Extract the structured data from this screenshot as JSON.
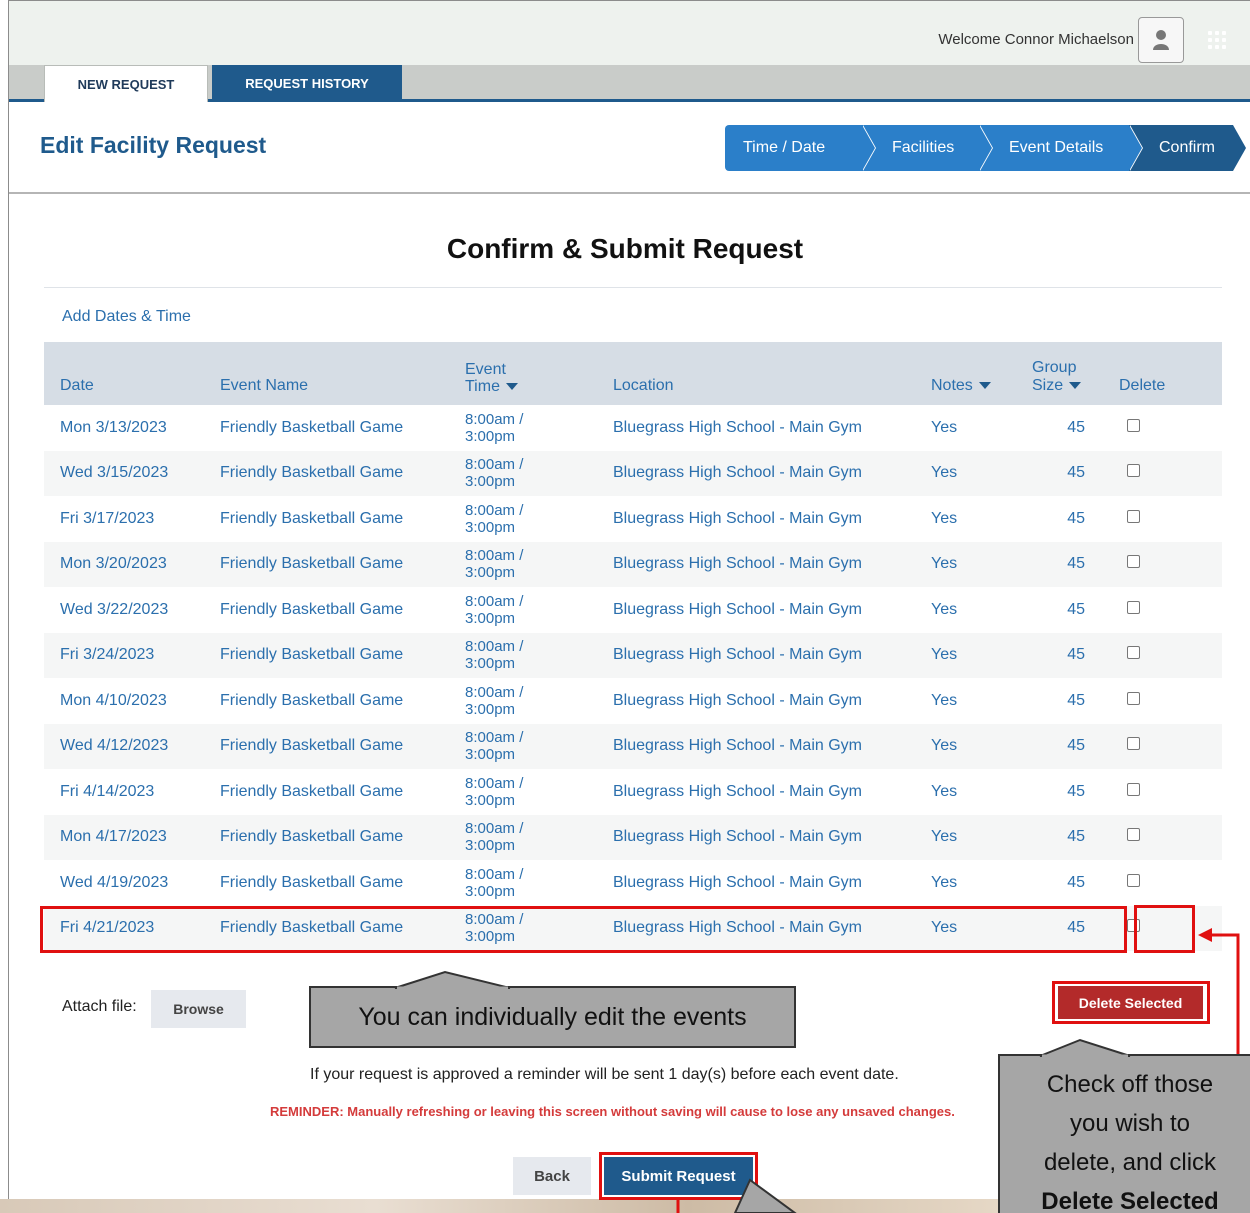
{
  "header": {
    "welcome": "Welcome Connor Michaelson",
    "tabs": [
      {
        "label": "NEW REQUEST",
        "active": true
      },
      {
        "label": "REQUEST HISTORY",
        "active": false
      }
    ]
  },
  "page": {
    "title": "Edit Facility Request",
    "steps": [
      "Time / Date",
      "Facilities",
      "Event Details",
      "Confirm"
    ],
    "heading": "Confirm & Submit Request",
    "add_link": "Add Dates & Time"
  },
  "table": {
    "columns": {
      "date": "Date",
      "event_name": "Event Name",
      "event_time": [
        "Event",
        "Time"
      ],
      "location": "Location",
      "notes": "Notes",
      "group_size": [
        "Group",
        "Size"
      ],
      "delete": "Delete"
    },
    "rows": [
      {
        "date": "Mon 3/13/2023",
        "name": "Friendly Basketball Game",
        "time1": "8:00am /",
        "time2": "3:00pm",
        "location": "Bluegrass High School - Main Gym",
        "notes": "Yes",
        "size": "45"
      },
      {
        "date": "Wed 3/15/2023",
        "name": "Friendly Basketball Game",
        "time1": "8:00am /",
        "time2": "3:00pm",
        "location": "Bluegrass High School - Main Gym",
        "notes": "Yes",
        "size": "45"
      },
      {
        "date": "Fri 3/17/2023",
        "name": "Friendly Basketball Game",
        "time1": "8:00am /",
        "time2": "3:00pm",
        "location": "Bluegrass High School - Main Gym",
        "notes": "Yes",
        "size": "45"
      },
      {
        "date": "Mon 3/20/2023",
        "name": "Friendly Basketball Game",
        "time1": "8:00am /",
        "time2": "3:00pm",
        "location": "Bluegrass High School - Main Gym",
        "notes": "Yes",
        "size": "45"
      },
      {
        "date": "Wed 3/22/2023",
        "name": "Friendly Basketball Game",
        "time1": "8:00am /",
        "time2": "3:00pm",
        "location": "Bluegrass High School - Main Gym",
        "notes": "Yes",
        "size": "45"
      },
      {
        "date": "Fri 3/24/2023",
        "name": "Friendly Basketball Game",
        "time1": "8:00am /",
        "time2": "3:00pm",
        "location": "Bluegrass High School - Main Gym",
        "notes": "Yes",
        "size": "45"
      },
      {
        "date": "Mon 4/10/2023",
        "name": "Friendly Basketball Game",
        "time1": "8:00am /",
        "time2": "3:00pm",
        "location": "Bluegrass High School - Main Gym",
        "notes": "Yes",
        "size": "45"
      },
      {
        "date": "Wed 4/12/2023",
        "name": "Friendly Basketball Game",
        "time1": "8:00am /",
        "time2": "3:00pm",
        "location": "Bluegrass High School - Main Gym",
        "notes": "Yes",
        "size": "45"
      },
      {
        "date": "Fri 4/14/2023",
        "name": "Friendly Basketball Game",
        "time1": "8:00am /",
        "time2": "3:00pm",
        "location": "Bluegrass High School - Main Gym",
        "notes": "Yes",
        "size": "45"
      },
      {
        "date": "Mon 4/17/2023",
        "name": "Friendly Basketball Game",
        "time1": "8:00am /",
        "time2": "3:00pm",
        "location": "Bluegrass High School - Main Gym",
        "notes": "Yes",
        "size": "45"
      },
      {
        "date": "Wed 4/19/2023",
        "name": "Friendly Basketball Game",
        "time1": "8:00am /",
        "time2": "3:00pm",
        "location": "Bluegrass High School - Main Gym",
        "notes": "Yes",
        "size": "45"
      },
      {
        "date": "Fri 4/21/2023",
        "name": "Friendly Basketball Game",
        "time1": "8:00am /",
        "time2": "3:00pm",
        "location": "Bluegrass High School - Main Gym",
        "notes": "Yes",
        "size": "45"
      }
    ]
  },
  "footer": {
    "attach_label": "Attach file:",
    "browse_label": "Browse",
    "delete_selected_label": "Delete Selected",
    "reminder_info": "If your request is approved a reminder will be sent 1 day(s) before each event date.",
    "reminder_warning": "REMINDER: Manually refreshing or leaving this screen without saving will cause to lose any unsaved changes.",
    "back_label": "Back",
    "submit_label": "Submit Request"
  },
  "annotations": {
    "callout_edit": "You can individually edit the events",
    "callout_delete_line1": "Check off those",
    "callout_delete_line2": "you wish to",
    "callout_delete_line3": "delete, and click",
    "callout_delete_bold": "Delete Selected",
    "highlight_color": "#e01010"
  },
  "colors": {
    "brand_blue": "#1f5a8c",
    "step_blue": "#2b7fc9",
    "link_blue": "#2b6fad",
    "danger": "#b32a2a"
  },
  "icons": [
    "user-icon",
    "apps-grid-icon",
    "sort-caret-icon",
    "checkbox-icon"
  ]
}
